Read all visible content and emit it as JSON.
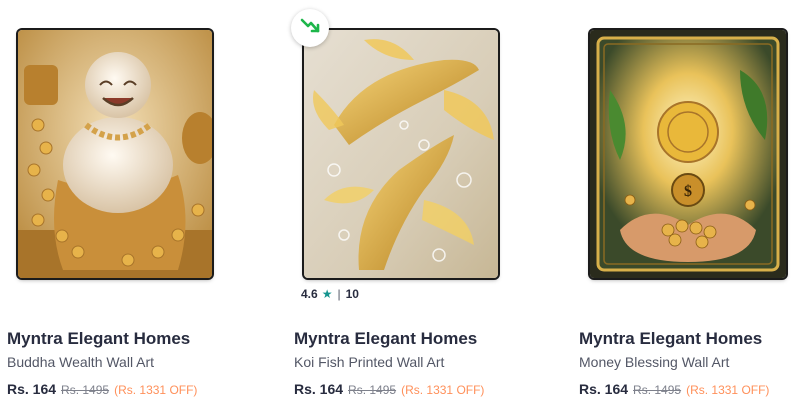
{
  "products": [
    {
      "brand": "Myntra Elegant Homes",
      "name": "Buddha Wealth Wall Art",
      "price": "Rs. 164",
      "mrp": "Rs. 1495",
      "discount": "(Rs. 1331 OFF)",
      "image": "laughing-buddha-gold-coins-image"
    },
    {
      "brand": "Myntra Elegant Homes",
      "name": "Koi Fish Printed Wall Art",
      "price": "Rs. 164",
      "mrp": "Rs. 1495",
      "discount": "(Rs. 1331 OFF)",
      "image": "golden-koi-fish-image",
      "rating": "4.6",
      "rating_count": "10",
      "rating_separator": "|",
      "badge_icon": "trending-down-icon"
    },
    {
      "brand": "Myntra Elegant Homes",
      "name": "Money Blessing Wall Art",
      "price": "Rs. 164",
      "mrp": "Rs. 1495",
      "discount": "(Rs. 1331 OFF)",
      "image": "money-blessing-hands-image"
    }
  ],
  "colors": {
    "brand_text": "#282c3f",
    "name_text": "#535766",
    "mrp_text": "#7e818c",
    "discount_text": "#ff905a",
    "rating_star": "#14958f",
    "badge_arrow": "#1db64a"
  }
}
